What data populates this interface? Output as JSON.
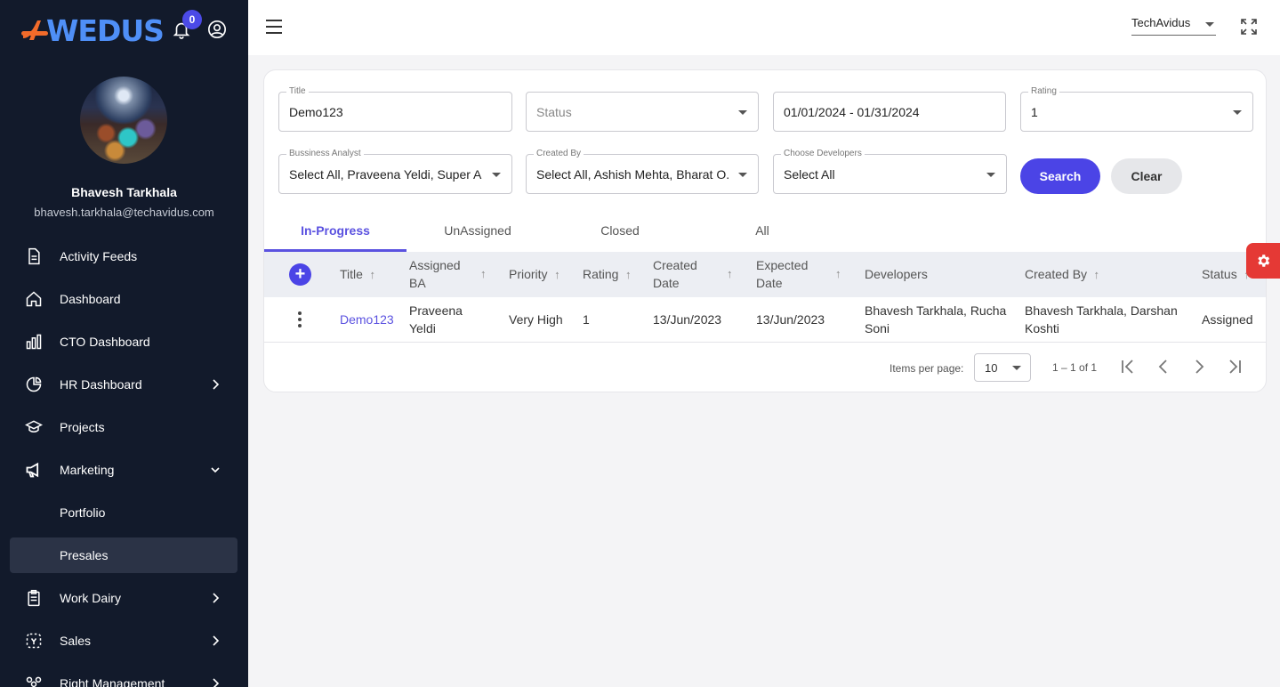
{
  "app": {
    "logo_text": "WEDUS",
    "notification_count": "0",
    "brand_colors": {
      "sidebar": "#121a2b",
      "accent": "#4b44e6",
      "logo_orange": "#f26b2a",
      "logo_blue": "#4f8ff7"
    }
  },
  "user": {
    "name": "Bhavesh Tarkhala",
    "email": "bhavesh.tarkhala@techavidus.com"
  },
  "sidebar": {
    "items": [
      {
        "label": "Activity Feeds",
        "icon": "document-icon"
      },
      {
        "label": "Dashboard",
        "icon": "home-icon"
      },
      {
        "label": "CTO Dashboard",
        "icon": "bar-chart-icon"
      },
      {
        "label": "HR Dashboard",
        "icon": "pie-chart-icon"
      },
      {
        "label": "Projects",
        "icon": "graduation-cap-icon"
      },
      {
        "label": "Marketing",
        "icon": "megaphone-icon"
      },
      {
        "label": "Portfolio"
      },
      {
        "label": "Presales"
      },
      {
        "label": "Work Dairy",
        "icon": "clipboard-icon"
      },
      {
        "label": "Sales",
        "icon": "sales-icon"
      },
      {
        "label": "Right Management",
        "icon": "people-icon"
      }
    ]
  },
  "header": {
    "org_name": "TechAvidus"
  },
  "filters": {
    "title": {
      "label": "Title",
      "value": "Demo123"
    },
    "status": {
      "placeholder": "Status"
    },
    "date_range": {
      "value": "01/01/2024 - 01/31/2024"
    },
    "rating": {
      "label": "Rating",
      "value": "1"
    },
    "business_analyst": {
      "label": "Bussiness Analyst",
      "value": "Select All, Praveena Yeldi, Super A..."
    },
    "created_by": {
      "label": "Created By",
      "value": "Select All, Ashish Mehta, Bharat O..."
    },
    "developers": {
      "label": "Choose Developers",
      "value": "Select All"
    },
    "search_label": "Search",
    "clear_label": "Clear"
  },
  "tabs": [
    {
      "label": "In-Progress",
      "active": true
    },
    {
      "label": "UnAssigned"
    },
    {
      "label": "Closed"
    },
    {
      "label": "All"
    }
  ],
  "table": {
    "headers": {
      "title": "Title",
      "assigned_ba_1": "Assigned",
      "assigned_ba_2": "BA",
      "priority": "Priority",
      "rating": "Rating",
      "created_1": "Created",
      "created_2": "Date",
      "expected_1": "Expected",
      "expected_2": "Date",
      "developers": "Developers",
      "created_by": "Created By",
      "status": "Status"
    },
    "rows": [
      {
        "title": "Demo123",
        "ba_1": "Praveena",
        "ba_2": "Yeldi",
        "priority": "Very High",
        "rating": "1",
        "created": "13/Jun/2023",
        "expected": "13/Jun/2023",
        "dev_1": "Bhavesh Tarkhala, Rucha",
        "dev_2": "Soni",
        "by_1": "Bhavesh Tarkhala, Darshan",
        "by_2": "Koshti",
        "status": "Assigned"
      }
    ]
  },
  "pagination": {
    "items_per_page_label": "Items per page:",
    "items_per_page": "10",
    "range": "1 – 1 of 1"
  }
}
